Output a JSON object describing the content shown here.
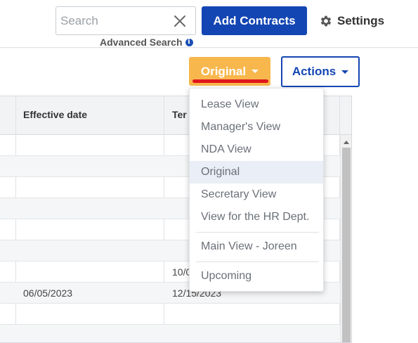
{
  "search": {
    "placeholder": "Search",
    "advanced_label": "Advanced Search"
  },
  "toolbar": {
    "add_label": "Add Contracts",
    "settings_label": "Settings"
  },
  "view_button": {
    "label": "Original"
  },
  "actions_button": {
    "label": "Actions"
  },
  "grid": {
    "columns": [
      "Effective date",
      "Ter"
    ],
    "rows": [
      [
        "",
        ""
      ],
      [
        "",
        ""
      ],
      [
        "",
        ""
      ],
      [
        "",
        ""
      ],
      [
        "",
        ""
      ],
      [
        "",
        ""
      ],
      [
        "",
        "10/0"
      ],
      [
        "06/05/2023",
        "12/15/2023"
      ],
      [
        "",
        ""
      ],
      [
        "",
        ""
      ]
    ]
  },
  "views_menu": {
    "items": [
      "Lease View",
      "Manager's View",
      "NDA View",
      "Original",
      "Secretary View",
      "View for the HR Dept.",
      "Main View - Joreen",
      "Upcoming"
    ],
    "selected": "Original"
  },
  "colors": {
    "primary": "#1346b3",
    "view_button": "#f8b74d",
    "highlight": "#e0161b"
  }
}
